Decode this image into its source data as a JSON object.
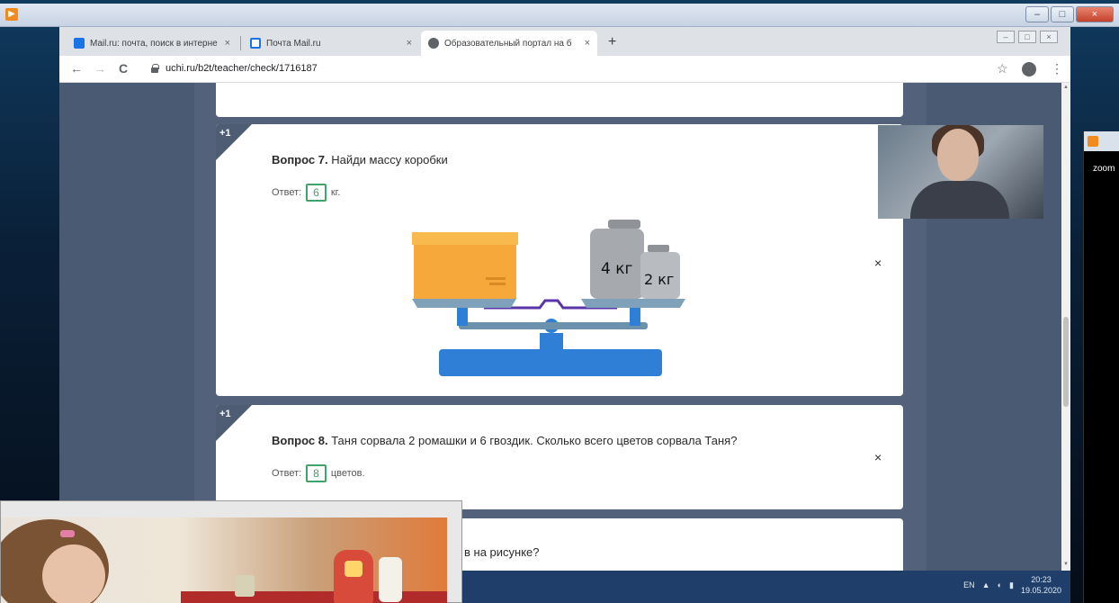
{
  "window": {
    "close_glyph": "×",
    "min_glyph": "–",
    "max_glyph": "□"
  },
  "browser": {
    "tabs": [
      {
        "label": "Mail.ru: почта, поиск в интерне",
        "icon": "mailru-icon",
        "close": "×"
      },
      {
        "label": "Почта Mail.ru",
        "icon": "mail-envelope-icon",
        "close": "×"
      },
      {
        "label": "Образовательный портал на б",
        "icon": "globe-icon",
        "close": "×"
      }
    ],
    "new_tab": "+",
    "url": "uchi.ru/b2t/teacher/check/1716187",
    "nav": {
      "back": "←",
      "forward": "→",
      "reload": "C"
    },
    "star": "☆",
    "menu": "⋮"
  },
  "page": {
    "q7": {
      "badge": "+1",
      "number": "Вопрос 7.",
      "text": "Найди массу коробки",
      "answer_label": "Ответ:",
      "answer_value": "6",
      "unit": "кг.",
      "weight_big": "4 кг",
      "weight_small": "2 кг",
      "remove": "×"
    },
    "q8": {
      "badge": "+1",
      "number": "Вопрос 8.",
      "text": "Таня сорвала 2 ромашки и 6 гвоздик. Сколько всего цветов сорвала Таня?",
      "answer_label": "Ответ:",
      "answer_value": "8",
      "unit": "цветов.",
      "remove": "×"
    },
    "q9": {
      "partial_text": "в на рисунке?"
    }
  },
  "zoom": {
    "label": "zoom"
  },
  "taskbar": {
    "lang": "EN",
    "time": "20:23",
    "date": "19.05.2020"
  },
  "colors": {
    "accent_green": "#3fa36b",
    "page_bg": "#53617a",
    "scale_blue": "#2f7fd6"
  }
}
